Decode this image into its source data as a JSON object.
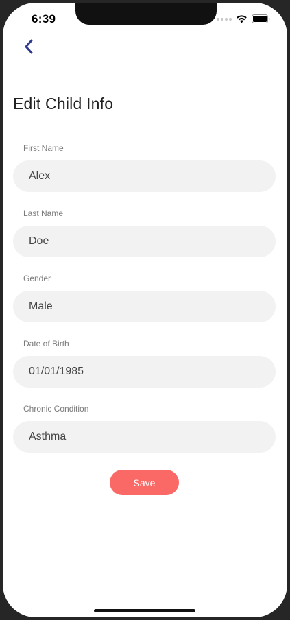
{
  "status_bar": {
    "time": "6:39"
  },
  "icons": {
    "back": "chevron-left-icon",
    "wifi": "wifi-icon",
    "battery": "battery-icon"
  },
  "colors": {
    "accent": "#2e3a8c",
    "save_button": "#fa6966",
    "input_background": "#f2f2f2"
  },
  "header": {
    "title": "Edit Child Info"
  },
  "form": {
    "fields": [
      {
        "label": "First Name",
        "value": "Alex"
      },
      {
        "label": "Last Name",
        "value": "Doe"
      },
      {
        "label": "Gender",
        "value": "Male"
      },
      {
        "label": "Date of Birth",
        "value": "01/01/1985"
      },
      {
        "label": "Chronic Condition",
        "value": "Asthma"
      }
    ],
    "save_label": "Save"
  }
}
